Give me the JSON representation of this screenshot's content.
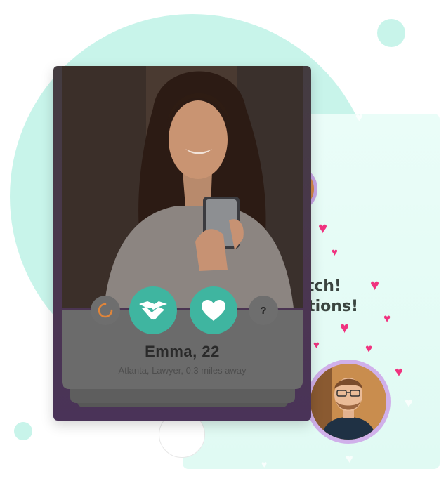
{
  "profile": {
    "name": "Emma, 22",
    "details": "Atlanta, Lawyer, 0.3 miles away"
  },
  "match": {
    "line1": "Match!",
    "line2": "ulations!"
  },
  "actions": {
    "undo_icon": "undo-icon",
    "match_icon": "handshake-icon",
    "like_icon": "heart-icon",
    "help_label": "?"
  },
  "colors": {
    "accent": "#3fb5a0",
    "heart": "#f0337f",
    "ring": "#c8f4ea"
  }
}
